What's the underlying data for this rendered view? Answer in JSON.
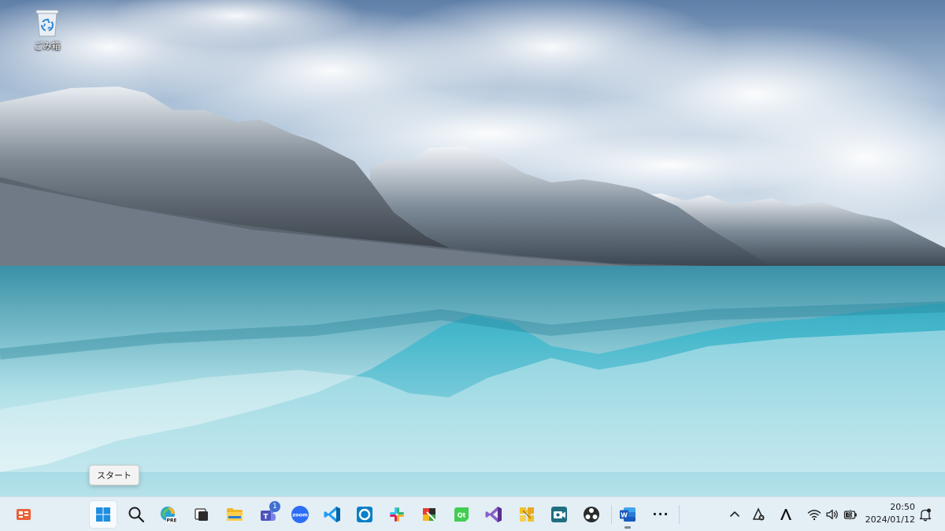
{
  "desktop": {
    "recycle_bin_label": "ごみ箱"
  },
  "tooltip": {
    "text": "スタート"
  },
  "taskbar": {
    "widgets": {
      "icon": "widgets-icon"
    },
    "pinned": [
      {
        "name": "start",
        "icon": "windows-start-icon",
        "active": true
      },
      {
        "name": "search",
        "icon": "search-icon"
      },
      {
        "name": "edge-beta",
        "icon": "edge-preview-icon",
        "overlay": "PRE"
      },
      {
        "name": "task-view",
        "icon": "task-view-icon"
      },
      {
        "name": "file-explorer",
        "icon": "folder-icon"
      },
      {
        "name": "teams",
        "icon": "teams-icon",
        "badge": "1"
      },
      {
        "name": "zoom",
        "icon": "zoom-icon",
        "text": "zoom"
      },
      {
        "name": "vscode",
        "icon": "vscode-icon"
      },
      {
        "name": "cortana",
        "icon": "ring-icon"
      },
      {
        "name": "slack",
        "icon": "slack-icon"
      },
      {
        "name": "paint-app",
        "icon": "paint-icon"
      },
      {
        "name": "qt-creator",
        "icon": "qt-icon",
        "text": "Qt"
      },
      {
        "name": "visual-studio",
        "icon": "visual-studio-icon"
      },
      {
        "name": "puzzle-app",
        "icon": "puzzle-icon"
      },
      {
        "name": "camera-app",
        "icon": "camera-icon"
      },
      {
        "name": "obs",
        "icon": "obs-icon"
      },
      {
        "name": "word",
        "icon": "word-icon",
        "text": "W",
        "running": true
      },
      {
        "name": "more",
        "icon": "more-dots-icon",
        "text": "···"
      }
    ],
    "tray": {
      "chevron": "chevron-up-icon",
      "items": [
        "tray-app-icon",
        "font-app-icon"
      ],
      "status": [
        "wifi-icon",
        "volume-icon",
        "battery-icon"
      ],
      "notification": "notification-bell-icon"
    },
    "clock": {
      "time": "20:50",
      "date": "2024/01/12"
    }
  }
}
